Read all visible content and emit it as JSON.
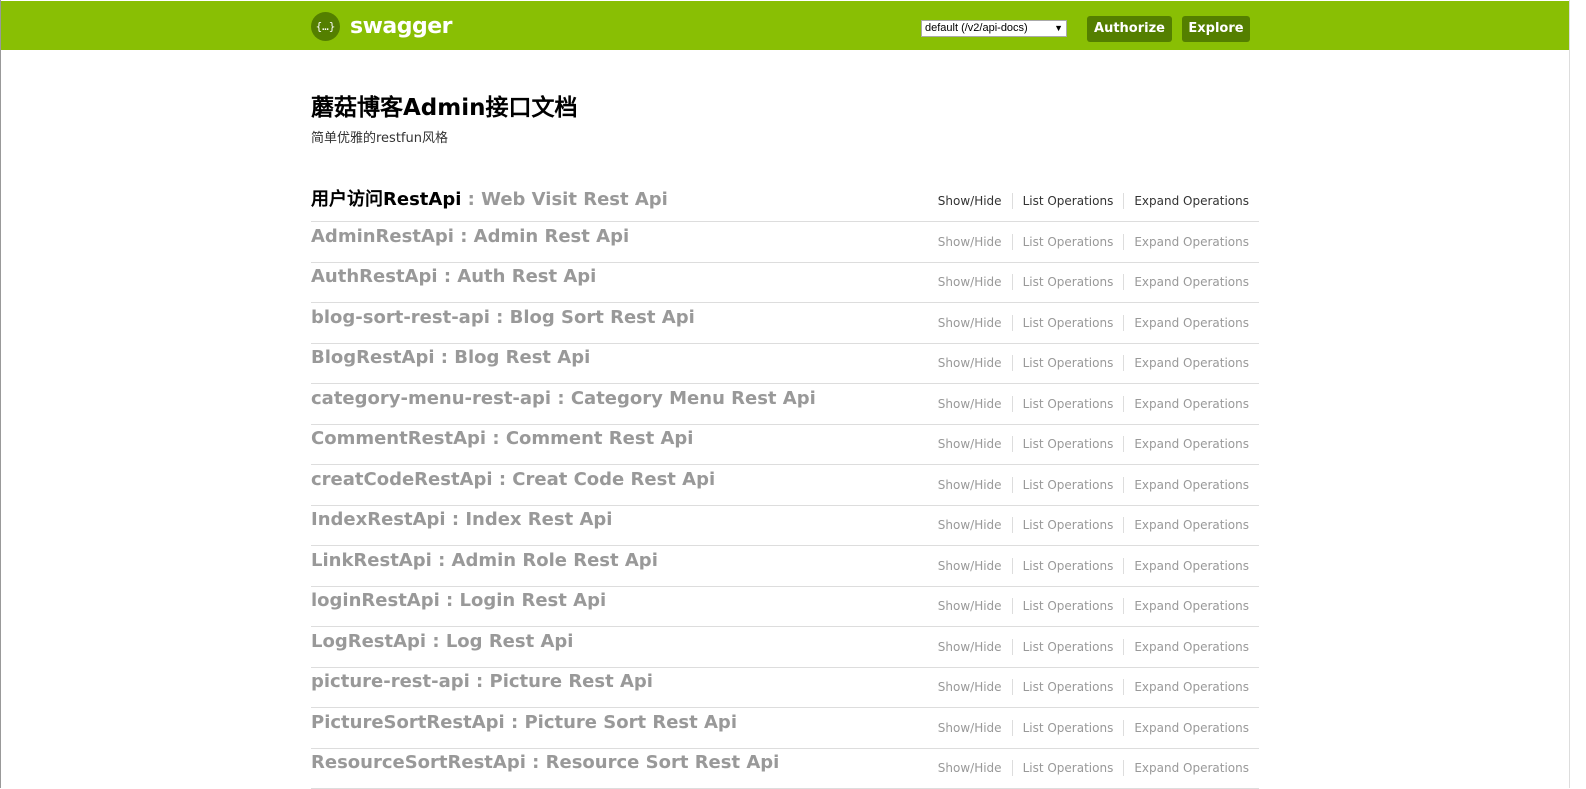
{
  "header": {
    "logo_text": "swagger",
    "logo_glyph": "{…}",
    "spec_select": "default (/v2/api-docs)",
    "authorize_label": "Authorize",
    "explore_label": "Explore",
    "bg_color": "#89bf04",
    "button_color": "#547f00"
  },
  "info": {
    "title": "蘑菇博客Admin接口文档",
    "description": "简单优雅的restfun风格"
  },
  "ops_labels": {
    "show_hide": "Show/Hide",
    "list": "List Operations",
    "expand": "Expand Operations"
  },
  "resources": [
    {
      "tag": "用户访问RestApi",
      "desc": " : Web Visit Rest Api"
    },
    {
      "tag": "AdminRestApi",
      "desc": " : Admin Rest Api"
    },
    {
      "tag": "AuthRestApi",
      "desc": " : Auth Rest Api"
    },
    {
      "tag": "blog-sort-rest-api",
      "desc": " : Blog Sort Rest Api"
    },
    {
      "tag": "BlogRestApi",
      "desc": " : Blog Rest Api"
    },
    {
      "tag": "category-menu-rest-api",
      "desc": " : Category Menu Rest Api"
    },
    {
      "tag": "CommentRestApi",
      "desc": " : Comment Rest Api"
    },
    {
      "tag": "creatCodeRestApi",
      "desc": " : Creat Code Rest Api"
    },
    {
      "tag": "IndexRestApi",
      "desc": " : Index Rest Api"
    },
    {
      "tag": "LinkRestApi",
      "desc": " : Admin Role Rest Api"
    },
    {
      "tag": "loginRestApi",
      "desc": " : Login Rest Api"
    },
    {
      "tag": "LogRestApi",
      "desc": " : Log Rest Api"
    },
    {
      "tag": "picture-rest-api",
      "desc": " : Picture Rest Api"
    },
    {
      "tag": "PictureSortRestApi",
      "desc": " : Picture Sort Rest Api"
    },
    {
      "tag": "ResourceSortRestApi",
      "desc": " : Resource Sort Rest Api"
    }
  ]
}
